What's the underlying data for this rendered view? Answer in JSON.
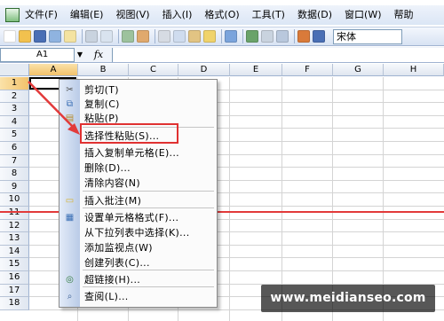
{
  "menubar": {
    "items": [
      "文件(F)",
      "编辑(E)",
      "视图(V)",
      "插入(I)",
      "格式(O)",
      "工具(T)",
      "数据(D)",
      "窗口(W)",
      "帮助"
    ]
  },
  "toolbar": {
    "font_name": "宋体"
  },
  "formula_bar": {
    "cell_reference": "A1",
    "fx_label": "fx"
  },
  "grid": {
    "columns": [
      "A",
      "B",
      "C",
      "D",
      "E",
      "F",
      "G",
      "H"
    ],
    "rows": [
      "1",
      "2",
      "3",
      "4",
      "5",
      "6",
      "7",
      "8",
      "9",
      "10",
      "11",
      "12",
      "13",
      "14",
      "15",
      "16",
      "17",
      "18"
    ],
    "active_column": "A",
    "active_row": "1"
  },
  "context_menu": {
    "items": [
      {
        "label": "剪切(T)",
        "icon": "scissors-icon"
      },
      {
        "label": "复制(C)",
        "icon": "copy-icon"
      },
      {
        "label": "粘贴(P)",
        "icon": "paste-icon"
      },
      {
        "label": "选择性粘贴(S)...",
        "icon": ""
      },
      {
        "label": "插入复制单元格(E)...",
        "icon": ""
      },
      {
        "label": "删除(D)...",
        "icon": ""
      },
      {
        "label": "清除内容(N)",
        "icon": ""
      },
      {
        "label": "插入批注(M)",
        "icon": "comment-icon"
      },
      {
        "label": "设置单元格格式(F)...",
        "icon": "format-cells-icon"
      },
      {
        "label": "从下拉列表中选择(K)...",
        "icon": ""
      },
      {
        "label": "添加监视点(W)",
        "icon": ""
      },
      {
        "label": "创建列表(C)...",
        "icon": ""
      },
      {
        "label": "超链接(H)...",
        "icon": "hyperlink-icon"
      },
      {
        "label": "查阅(L)...",
        "icon": "research-icon"
      }
    ]
  },
  "colors": {
    "annotation_red": "#e03131",
    "menu_strip": "#b9cbe7"
  },
  "watermark": {
    "text": "www.meidianseo.com"
  }
}
